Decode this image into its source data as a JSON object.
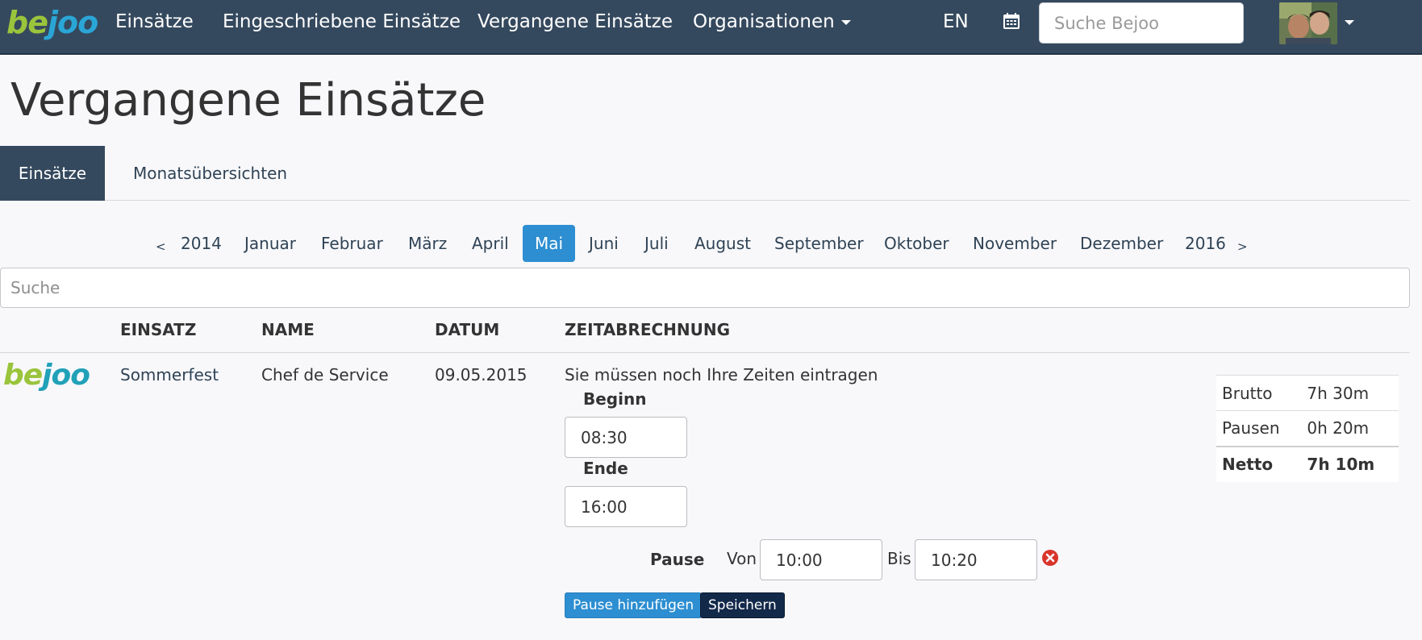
{
  "navbar": {
    "logo_part1": "be",
    "logo_part2": "joo",
    "links": [
      "Einsätze",
      "Eingeschriebene Einsätze",
      "Vergangene Einsätze"
    ],
    "organisations_label": "Organisationen",
    "language": "EN",
    "search_placeholder": "Suche Bejoo"
  },
  "page": {
    "title": "Vergangene Einsätze"
  },
  "tabs": [
    "Einsätze",
    "Monatsübersichten"
  ],
  "pager": {
    "prev": "<",
    "prev_year": "2014",
    "months": [
      "Januar",
      "Februar",
      "März",
      "April",
      "Mai",
      "Juni",
      "Juli",
      "August",
      "September",
      "Oktober",
      "November",
      "Dezember"
    ],
    "active_month": "Mai",
    "next_year": "2016",
    "next": ">"
  },
  "search": {
    "placeholder": "Suche"
  },
  "table": {
    "headers": [
      "EINSATZ",
      "NAME",
      "DATUM",
      "ZEITABRECHNUNG"
    ],
    "row": {
      "logo_part1": "be",
      "logo_part2": "joo",
      "einsatz": "Sommerfest",
      "name": "Chef de Service",
      "datum": "09.05.2015",
      "notice": "Sie müssen noch Ihre Zeiten eintragen",
      "beginn_label": "Beginn",
      "beginn_value": "08:30",
      "ende_label": "Ende",
      "ende_value": "16:00",
      "pause_label": "Pause",
      "von_label": "Von",
      "von_value": "10:00",
      "bis_label": "Bis",
      "bis_value": "10:20",
      "add_pause_label": "Pause hinzufügen",
      "save_label": "Speichern",
      "summary": {
        "brutto_label": "Brutto",
        "brutto_value": "7h 30m",
        "pausen_label": "Pausen",
        "pausen_value": "0h 20m",
        "netto_label": "Netto",
        "netto_value": "7h 10m"
      }
    }
  },
  "colors": {
    "navbar": "#35495e",
    "accent": "#2d8ed1",
    "save_button": "#13294a",
    "logo_green": "#9ac43c",
    "logo_blue": "#2aa6d6",
    "remove_icon": "#d9342b"
  }
}
